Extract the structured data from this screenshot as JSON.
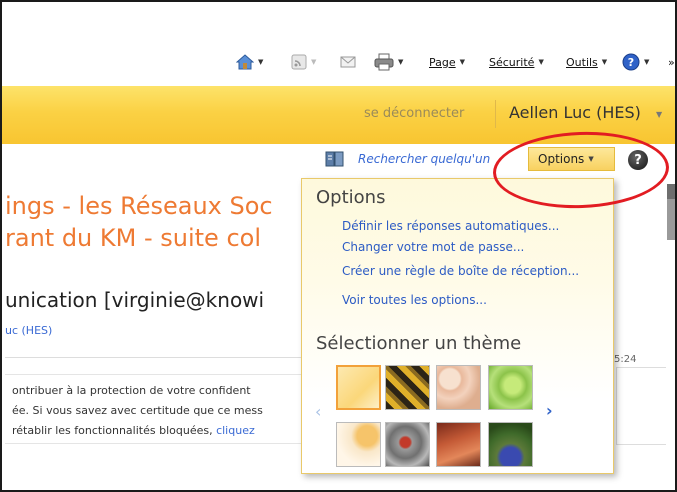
{
  "toolbar": {
    "page": "Page",
    "security": "Sécurité",
    "tools": "Outils",
    "overflow": "»"
  },
  "header": {
    "signout": "se déconnecter",
    "user": "Aellen Luc (HES)"
  },
  "people_search": "Rechercher quelqu'un",
  "options_button": "Options",
  "help": "?",
  "email": {
    "subject_line1": "ings - les Réseaux Soc",
    "subject_line2": "rant du KM - suite col",
    "from": "unication [virginie@knowi",
    "from_sub": "uc (HES)",
    "time": "5:24",
    "warning_line1": "ontribuer à la protection de votre confident",
    "warning_line2": "ée. Si vous savez avec certitude que ce mess",
    "warning_line3": "rétablir les fonctionnalités bloquées,",
    "warning_link": "cliquez"
  },
  "dropdown": {
    "title": "Options",
    "links": [
      "Définir les réponses automatiques...",
      "Changer votre mot de passe...",
      "Créer une règle de boîte de réception...",
      "Voir toutes les options..."
    ],
    "theme_title": "Sélectionner un thème",
    "prev": "‹",
    "next": "›"
  },
  "colors": {
    "accent_yellow": "#f8c531",
    "link_blue": "#2c5bc4",
    "subject_orange": "#ee7a33",
    "annotation_red": "#e21c22"
  }
}
